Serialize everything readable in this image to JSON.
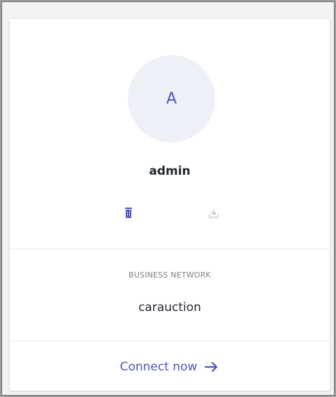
{
  "card": {
    "avatar_letter": "A",
    "username": "admin",
    "actions": {
      "delete_icon": "trash-icon",
      "export_icon": "download-icon"
    },
    "network": {
      "label": "BUSINESS NETWORK",
      "name": "carauction"
    },
    "connect": {
      "label": "Connect now",
      "icon": "arrow-right-icon"
    }
  },
  "colors": {
    "accent": "#4c55b8",
    "avatar_bg": "#eef0f7",
    "muted_icon": "#c7cbd4",
    "text": "#222831",
    "label": "#7c7f88"
  }
}
